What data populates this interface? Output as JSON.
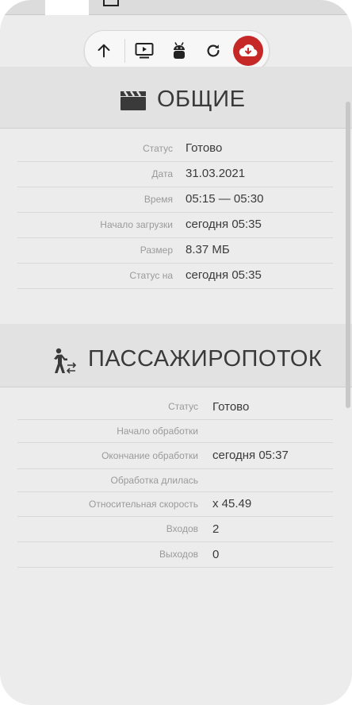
{
  "toolbar": {
    "buttons": [
      {
        "icon": "arrow-up-icon"
      },
      {
        "icon": "monitor-play-icon"
      },
      {
        "icon": "android-icon"
      },
      {
        "icon": "refresh-icon"
      },
      {
        "icon": "cloud-download-icon",
        "color": "#c62828"
      }
    ]
  },
  "general": {
    "title": "ОБЩИЕ",
    "icon": "clapperboard-icon",
    "rows": [
      {
        "label": "Статус",
        "value": "Готово"
      },
      {
        "label": "Дата",
        "value": "31.03.2021"
      },
      {
        "label": "Время",
        "value": "05:15 — 05:30"
      },
      {
        "label": "Начало загрузки",
        "value": "сегодня 05:35"
      },
      {
        "label": "Размер",
        "value": "8.37 МБ"
      },
      {
        "label": "Статус на",
        "value": "сегодня 05:35"
      }
    ]
  },
  "passenger_flow": {
    "title": "ПАССАЖИРОПОТОК",
    "icon": "person-walking-arrows-icon",
    "rows": [
      {
        "label": "Статус",
        "value": "Готово"
      },
      {
        "label": "Начало обработки",
        "value": ""
      },
      {
        "label": "Окончание обработки",
        "value": "сегодня 05:37"
      },
      {
        "label": "Обработка длилась",
        "value": ""
      },
      {
        "label": "Относительная скорость",
        "value": "x 45.49"
      },
      {
        "label": "Входов",
        "value": "2"
      },
      {
        "label": "Выходов",
        "value": "0"
      }
    ]
  },
  "colors": {
    "accent": "#c62828",
    "background": "#ececec",
    "header": "#e2e2e2"
  }
}
